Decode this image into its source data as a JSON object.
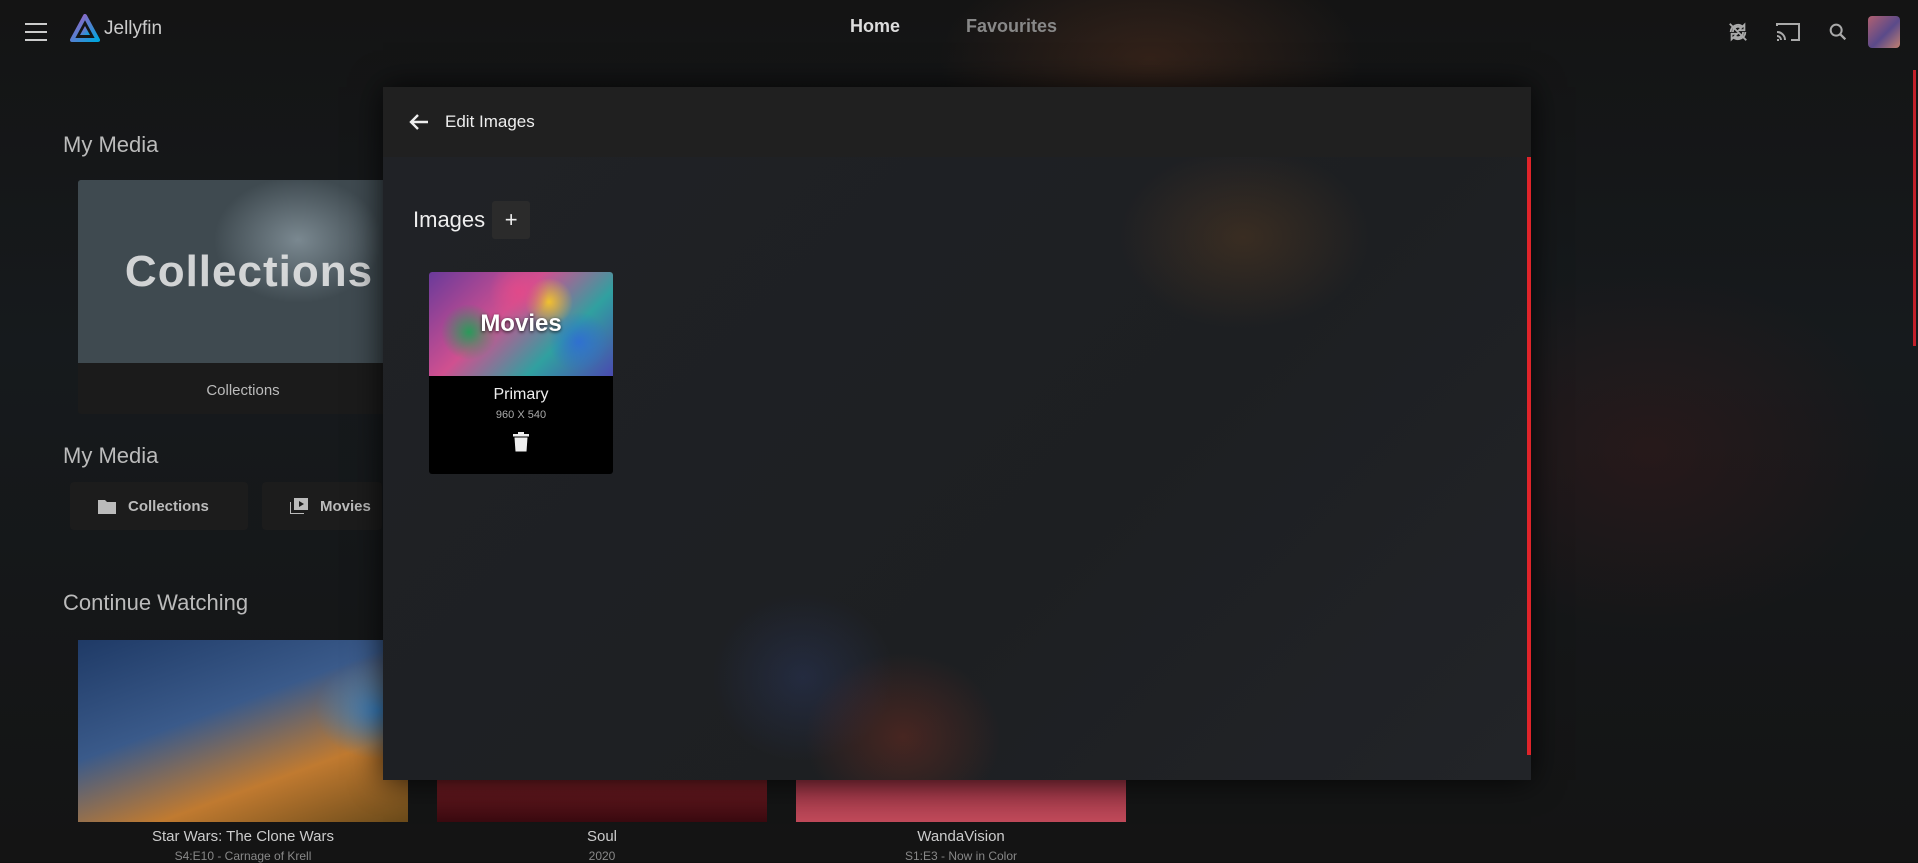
{
  "app": {
    "name": "Jellyfin"
  },
  "header": {
    "tabs": [
      {
        "label": "Home",
        "active": true
      },
      {
        "label": "Favourites",
        "active": false
      }
    ],
    "icons": [
      "sync-disabled-icon",
      "cast-icon",
      "search-icon",
      "user-avatar"
    ]
  },
  "background": {
    "my_media_title_1": "My Media",
    "collections_card": {
      "thumb_text": "Collections",
      "caption": "Collections"
    },
    "my_media_title_2": "My Media",
    "library_buttons": [
      {
        "label": "Collections",
        "icon": "folder-icon"
      },
      {
        "label": "Movies",
        "icon": "movie-library-icon"
      }
    ],
    "continue_watching_title": "Continue Watching",
    "continue_watching": [
      {
        "title": "Star Wars: The Clone Wars",
        "subtitle": "S4:E10 - Carnage of Krell"
      },
      {
        "title": "Soul",
        "subtitle": "2020"
      },
      {
        "title": "WandaVision",
        "subtitle": "S1:E3 - Now in Color"
      }
    ]
  },
  "dialog": {
    "title": "Edit Images",
    "images_label": "Images",
    "add_label": "+",
    "images": [
      {
        "thumb_text": "Movies",
        "type": "Primary",
        "dimensions": "960 X 540"
      }
    ]
  },
  "colors": {
    "accent": "#e0242a",
    "dialog_bg": "#1c1c1c",
    "page_bg": "#101010"
  }
}
